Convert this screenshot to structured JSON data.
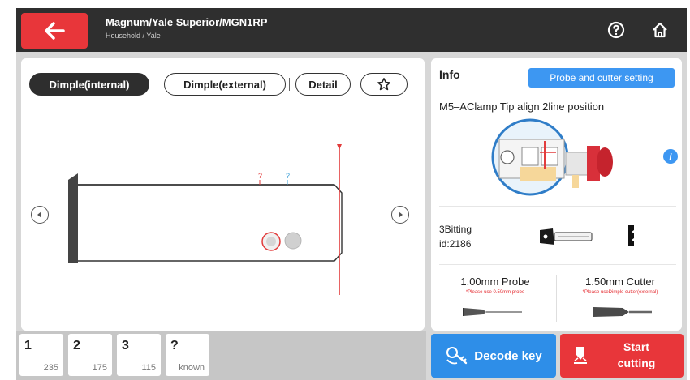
{
  "header": {
    "title": "Magnum/Yale Superior/MGN1RP",
    "subtitle": "Household / Yale"
  },
  "tabs": [
    {
      "label": "Dimple(internal)",
      "active": true
    },
    {
      "label": "Dimple(external)",
      "active": false
    },
    {
      "label": "Detail",
      "active": false
    }
  ],
  "key_view": {
    "markers": [
      "?",
      "?"
    ]
  },
  "cuts": [
    {
      "num": "1",
      "value": "235"
    },
    {
      "num": "2",
      "value": "175"
    },
    {
      "num": "3",
      "value": "115"
    },
    {
      "num": "?",
      "value": "known"
    }
  ],
  "info": {
    "label": "Info",
    "probe_setting_button": "Probe and cutter setting",
    "clamp_text": "M5–AClamp Tip align 2line position",
    "bitting": "3Bitting",
    "id": "id:2186",
    "probe_title": "1.00mm Probe",
    "probe_note": "*Please use 0.50mm probe",
    "cutter_title": "1.50mm Cutter",
    "cutter_note": "*Please useDimple cutter(external)"
  },
  "actions": {
    "decode": "Decode key",
    "start_line1": "Start",
    "start_line2": "cutting"
  },
  "colors": {
    "accent_red": "#e8363a",
    "accent_blue": "#2e8ee8",
    "header_bg": "#2f2f2f"
  }
}
